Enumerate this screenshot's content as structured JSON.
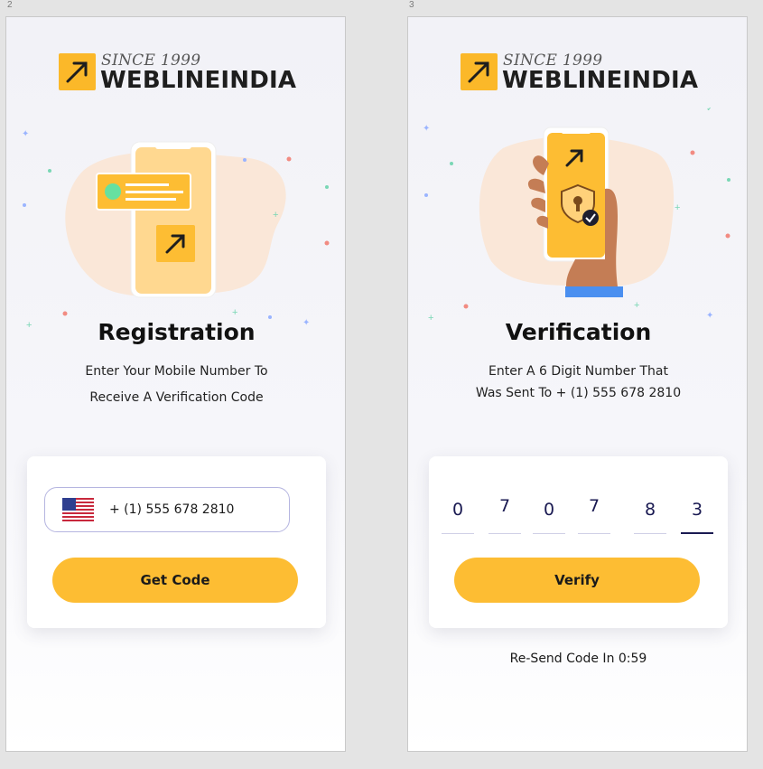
{
  "artboards": [
    {
      "number": "2"
    },
    {
      "number": "3"
    }
  ],
  "brand": {
    "since": "SINCE 1999",
    "name": "WEBLINEINDIA"
  },
  "registration": {
    "title": "Registration",
    "subtitle_line1": "Enter Your Mobile Number To",
    "subtitle_line2": "Receive A Verification Code",
    "country_flag": "us-flag-icon",
    "phone_value": "+ (1) 555 678 2810",
    "button_label": "Get Code"
  },
  "verification": {
    "title": "Verification",
    "subtitle_line1": "Enter A 6 Digit Number That",
    "subtitle_line2": "Was Sent To + (1) 555 678 2810",
    "digits": [
      "0",
      "7",
      "0",
      "7",
      "8",
      "3"
    ],
    "button_label": "Verify",
    "resend_text": "Re-Send Code In 0:59"
  },
  "colors": {
    "accent": "#fdbd33",
    "text_dark": "#1a1a52",
    "screen_bg": "#f2f2f7"
  }
}
